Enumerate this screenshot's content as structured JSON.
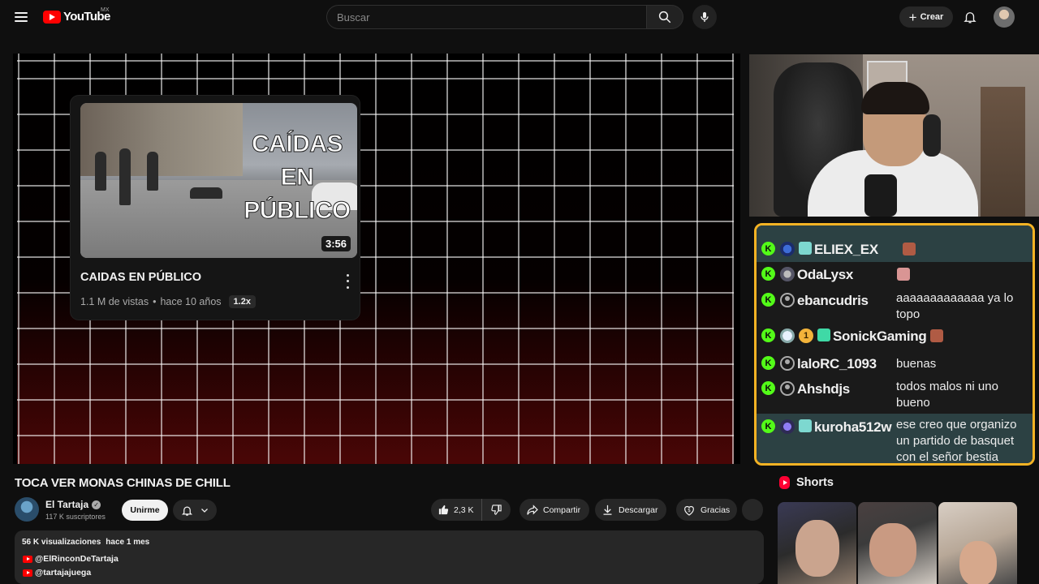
{
  "header": {
    "logo_text": "YouTube",
    "region": "MX",
    "search_placeholder": "Buscar",
    "create_label": "Crear"
  },
  "player": {
    "recommendation": {
      "thumb_text_lines": [
        "CAÍDAS",
        "EN",
        "PÚBLICO"
      ],
      "duration": "3:56",
      "title": "CAIDAS EN PÚBLICO",
      "views": "1.1 M de vistas",
      "age": "hace 10 años",
      "speed": "1.2x"
    }
  },
  "chat": {
    "messages": [
      {
        "user": "ELIEX_EX",
        "text": ""
      },
      {
        "user": "OdaLysx",
        "text": ""
      },
      {
        "user": "ebancudris",
        "text": "aaaaaaaaaaaaa ya lo topo"
      },
      {
        "user": "SonickGaming",
        "text": "",
        "coin": "1"
      },
      {
        "user": "laloRC_1093",
        "text": "buenas"
      },
      {
        "user": "Ahshdjs",
        "text": "todos malos ni uno bueno"
      },
      {
        "user": "kuroha512w",
        "text": "ese creo que organizo un partido de basquet con el señor bestia"
      }
    ],
    "badge_letter": "K"
  },
  "video": {
    "title": "TOCA VER MONAS CHINAS DE CHILL",
    "channel_name": "El Tartaja",
    "subscribers": "117 K suscriptores",
    "join_label": "Unirme",
    "likes": "2,3 K",
    "share_label": "Compartir",
    "download_label": "Descargar",
    "thanks_label": "Gracias"
  },
  "description": {
    "views": "56 K visualizaciones",
    "age": "hace 1 mes",
    "links": [
      "@ElRinconDeTartaja",
      "@tartajajuega"
    ]
  },
  "shorts": {
    "title": "Shorts"
  },
  "colors": {
    "chat_border": "#f5b324",
    "kick_green": "#53fc18",
    "yt_red": "#ff0000"
  }
}
